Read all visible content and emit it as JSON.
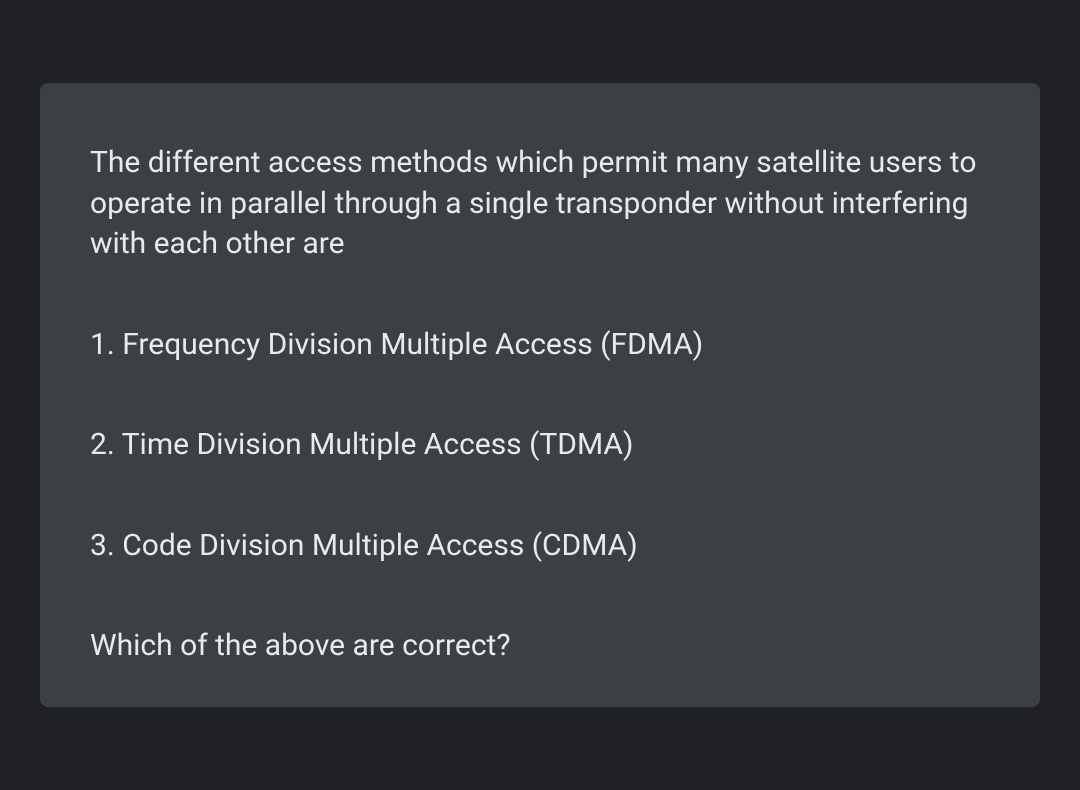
{
  "question": {
    "stem": "The different access methods which permit many satellite users to operate in parallel through a single transponder without interfering with each other are",
    "options": [
      "1. Frequency Division Multiple Access (FDMA)",
      "2. Time Division Multiple Access (TDMA)",
      "3. Code Division Multiple Access (CDMA)"
    ],
    "closing": "Which of the above are correct?"
  }
}
